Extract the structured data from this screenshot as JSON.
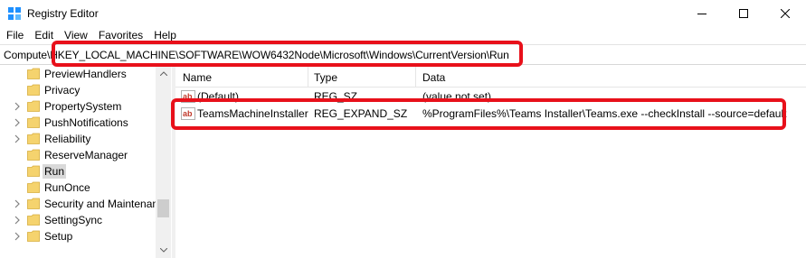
{
  "window": {
    "title": "Registry Editor",
    "icon": "registry-editor-icon",
    "controls": [
      "minimize-icon",
      "maximize-icon",
      "close-icon"
    ]
  },
  "menu": [
    "File",
    "Edit",
    "View",
    "Favorites",
    "Help"
  ],
  "address": {
    "prefix": "Compute",
    "path": "\\HKEY_LOCAL_MACHINE\\SOFTWARE\\WOW6432Node\\Microsoft\\Windows\\CurrentVersion\\Run"
  },
  "tree": {
    "items": [
      {
        "label": "PreviewHandlers",
        "expander": false,
        "selected": false
      },
      {
        "label": "Privacy",
        "expander": false,
        "selected": false
      },
      {
        "label": "PropertySystem",
        "expander": true,
        "selected": false
      },
      {
        "label": "PushNotifications",
        "expander": true,
        "selected": false
      },
      {
        "label": "Reliability",
        "expander": true,
        "selected": false
      },
      {
        "label": "ReserveManager",
        "expander": false,
        "selected": false
      },
      {
        "label": "Run",
        "expander": false,
        "selected": true
      },
      {
        "label": "RunOnce",
        "expander": false,
        "selected": false
      },
      {
        "label": "Security and Maintenan",
        "expander": true,
        "selected": false
      },
      {
        "label": "SettingSync",
        "expander": true,
        "selected": false
      },
      {
        "label": "Setup",
        "expander": true,
        "selected": false
      }
    ]
  },
  "list": {
    "columns": [
      "Name",
      "Type",
      "Data"
    ],
    "rows": [
      {
        "name": "(Default)",
        "type": "REG_SZ",
        "data": "(value not set)",
        "icon": "string-value-icon"
      },
      {
        "name": "TeamsMachineInstaller",
        "type": "REG_EXPAND_SZ",
        "data": "%ProgramFiles%\\Teams Installer\\Teams.exe --checkInstall --source=default",
        "icon": "string-value-icon"
      }
    ]
  },
  "colors": {
    "highlight": "#e8101a",
    "folder": "#f5d36e",
    "selection": "#d9d9d9"
  }
}
